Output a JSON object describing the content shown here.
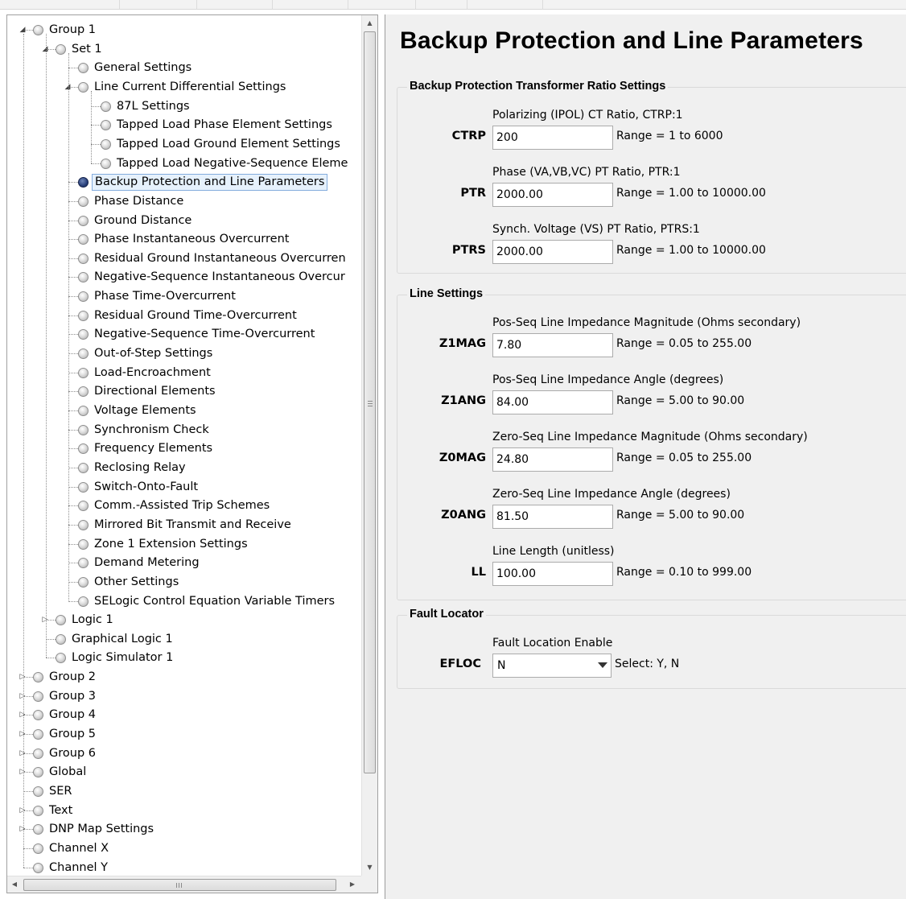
{
  "tree": {
    "nodes": [
      {
        "label": "Group 1",
        "level": 0,
        "expander": "expanded"
      },
      {
        "label": "Set 1",
        "level": 1,
        "expander": "expanded"
      },
      {
        "label": "General Settings",
        "level": 2,
        "expander": "none"
      },
      {
        "label": "Line Current Differential Settings",
        "level": 2,
        "expander": "expanded"
      },
      {
        "label": "87L Settings",
        "level": 3,
        "expander": "none"
      },
      {
        "label": "Tapped Load Phase Element Settings",
        "level": 3,
        "expander": "none"
      },
      {
        "label": "Tapped Load Ground Element Settings",
        "level": 3,
        "expander": "none"
      },
      {
        "label": "Tapped Load Negative-Sequence Eleme",
        "level": 3,
        "expander": "none"
      },
      {
        "label": "Backup Protection and Line Parameters",
        "level": 2,
        "expander": "none",
        "selected": true
      },
      {
        "label": "Phase Distance",
        "level": 2,
        "expander": "none"
      },
      {
        "label": "Ground Distance",
        "level": 2,
        "expander": "none"
      },
      {
        "label": "Phase Instantaneous Overcurrent",
        "level": 2,
        "expander": "none"
      },
      {
        "label": "Residual Ground Instantaneous Overcurren",
        "level": 2,
        "expander": "none"
      },
      {
        "label": "Negative-Sequence Instantaneous Overcur",
        "level": 2,
        "expander": "none"
      },
      {
        "label": "Phase Time-Overcurrent",
        "level": 2,
        "expander": "none"
      },
      {
        "label": "Residual Ground Time-Overcurrent",
        "level": 2,
        "expander": "none"
      },
      {
        "label": "Negative-Sequence Time-Overcurrent",
        "level": 2,
        "expander": "none"
      },
      {
        "label": "Out-of-Step Settings",
        "level": 2,
        "expander": "none"
      },
      {
        "label": "Load-Encroachment",
        "level": 2,
        "expander": "none"
      },
      {
        "label": "Directional Elements",
        "level": 2,
        "expander": "none"
      },
      {
        "label": "Voltage Elements",
        "level": 2,
        "expander": "none"
      },
      {
        "label": "Synchronism Check",
        "level": 2,
        "expander": "none"
      },
      {
        "label": "Frequency Elements",
        "level": 2,
        "expander": "none"
      },
      {
        "label": "Reclosing Relay",
        "level": 2,
        "expander": "none"
      },
      {
        "label": "Switch-Onto-Fault",
        "level": 2,
        "expander": "none"
      },
      {
        "label": "Comm.-Assisted Trip Schemes",
        "level": 2,
        "expander": "none"
      },
      {
        "label": "Mirrored Bit Transmit and Receive",
        "level": 2,
        "expander": "none"
      },
      {
        "label": "Zone 1 Extension Settings",
        "level": 2,
        "expander": "none"
      },
      {
        "label": "Demand Metering",
        "level": 2,
        "expander": "none"
      },
      {
        "label": "Other Settings",
        "level": 2,
        "expander": "none"
      },
      {
        "label": "SELogic Control Equation Variable Timers",
        "level": 2,
        "expander": "none"
      },
      {
        "label": "Logic 1",
        "level": 1,
        "expander": "collapsed"
      },
      {
        "label": "Graphical Logic 1",
        "level": 1,
        "expander": "none"
      },
      {
        "label": "Logic Simulator 1",
        "level": 1,
        "expander": "none"
      },
      {
        "label": "Group 2",
        "level": 0,
        "expander": "collapsed"
      },
      {
        "label": "Group 3",
        "level": 0,
        "expander": "collapsed"
      },
      {
        "label": "Group 4",
        "level": 0,
        "expander": "collapsed"
      },
      {
        "label": "Group 5",
        "level": 0,
        "expander": "collapsed"
      },
      {
        "label": "Group 6",
        "level": 0,
        "expander": "collapsed"
      },
      {
        "label": "Global",
        "level": 0,
        "expander": "collapsed"
      },
      {
        "label": "SER",
        "level": 0,
        "expander": "none"
      },
      {
        "label": "Text",
        "level": 0,
        "expander": "collapsed"
      },
      {
        "label": "DNP Map Settings",
        "level": 0,
        "expander": "collapsed"
      },
      {
        "label": "Channel X",
        "level": 0,
        "expander": "none"
      },
      {
        "label": "Channel Y",
        "level": 0,
        "expander": "none"
      }
    ]
  },
  "page": {
    "title": "Backup Protection and Line Parameters"
  },
  "sections": {
    "backup": {
      "title": "Backup Protection Transformer Ratio Settings",
      "fields": [
        {
          "name": "CTRP",
          "desc": "Polarizing (IPOL) CT Ratio, CTRP:1",
          "value": "200",
          "range": "Range = 1 to 6000"
        },
        {
          "name": "PTR",
          "desc": "Phase (VA,VB,VC) PT Ratio, PTR:1",
          "value": "2000.00",
          "range": "Range = 1.00 to 10000.00"
        },
        {
          "name": "PTRS",
          "desc": "Synch. Voltage (VS) PT Ratio, PTRS:1",
          "value": "2000.00",
          "range": "Range = 1.00 to 10000.00"
        }
      ]
    },
    "line": {
      "title": "Line Settings",
      "fields": [
        {
          "name": "Z1MAG",
          "desc": "Pos-Seq Line Impedance Magnitude (Ohms secondary)",
          "value": "7.80",
          "range": "Range = 0.05 to 255.00"
        },
        {
          "name": "Z1ANG",
          "desc": "Pos-Seq Line Impedance Angle (degrees)",
          "value": "84.00",
          "range": "Range = 5.00 to 90.00"
        },
        {
          "name": "Z0MAG",
          "desc": "Zero-Seq Line Impedance Magnitude (Ohms secondary)",
          "value": "24.80",
          "range": "Range = 0.05 to 255.00"
        },
        {
          "name": "Z0ANG",
          "desc": "Zero-Seq Line Impedance Angle (degrees)",
          "value": "81.50",
          "range": "Range = 5.00 to 90.00"
        },
        {
          "name": "LL",
          "desc": "Line Length (unitless)",
          "value": "100.00",
          "range": "Range = 0.10 to 999.00"
        }
      ]
    },
    "fault": {
      "title": "Fault Locator",
      "fields": [
        {
          "name": "EFLOC",
          "desc": "Fault Location Enable",
          "value": "N",
          "range": "Select: Y, N",
          "type": "select"
        }
      ]
    }
  },
  "scrollbars": {
    "vertical": {
      "up_arrow": "up-arrow-icon",
      "down_arrow": "down-arrow-icon",
      "grip": "grip-icon"
    },
    "horizontal": {
      "left_arrow": "left-arrow-icon",
      "right_arrow": "right-arrow-icon",
      "grip": "grip-icon"
    }
  },
  "colors": {
    "selection_fill": "#e6f1fc",
    "selection_border": "#84acdd",
    "active_bullet": "#29407a",
    "panel_bg": "#f0f0f0"
  }
}
